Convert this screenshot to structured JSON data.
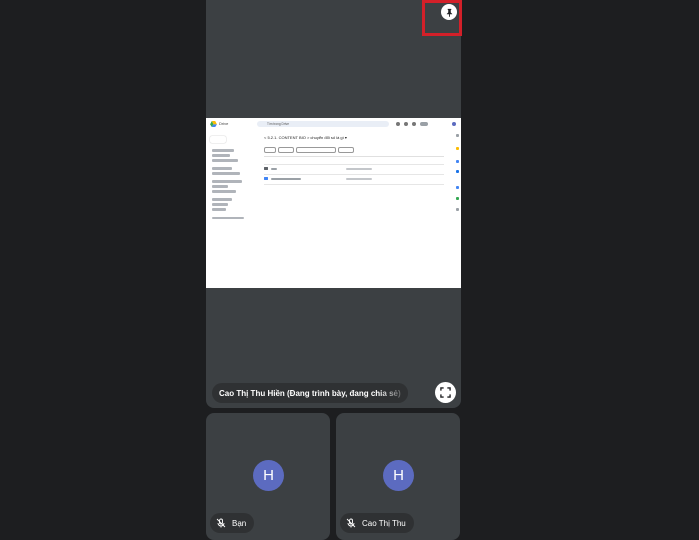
{
  "main": {
    "presenter_label": "Cao Thị Thu Hiền (Đang trình bày, đang chia sẻ)",
    "pin_icon": "pin-icon",
    "fullscreen_icon": "fullscreen-icon"
  },
  "shared_screen": {
    "app_name": "Drive",
    "search_placeholder": "Tìm trong Drive",
    "breadcrumb": "< 5.2.1. CONTENT BIO > chuyển đổi số là gì ▾"
  },
  "participants": [
    {
      "avatar_letter": "H",
      "name": "Bạn",
      "mic_icon": "mic-off-icon",
      "avatar_color": "#5c6bc0"
    },
    {
      "avatar_letter": "H",
      "name": "Cao Thị Thu",
      "mic_icon": "mic-off-icon",
      "avatar_color": "#5c6bc0"
    }
  ],
  "colors": {
    "background": "#1d1e20",
    "tile": "#3c4043",
    "highlight": "#d32029"
  }
}
